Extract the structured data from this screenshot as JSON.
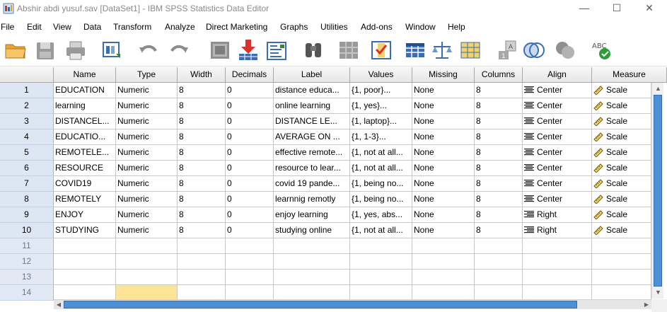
{
  "window": {
    "title": "Abshir abdi yusuf.sav [DataSet1] - IBM SPSS Statistics Data Editor",
    "minimize": "—",
    "maximize": "☐",
    "close": "✕"
  },
  "menu": [
    "File",
    "Edit",
    "View",
    "Data",
    "Transform",
    "Analyze",
    "Direct Marketing",
    "Graphs",
    "Utilities",
    "Add-ons",
    "Window",
    "Help"
  ],
  "toolbar": {
    "icons": [
      "open-folder-icon",
      "save-icon",
      "print-icon",
      "recall-dialog-icon",
      "undo-icon",
      "redo-icon",
      "goto-case-icon",
      "goto-variable-icon",
      "variables-icon",
      "find-icon",
      "insert-cases-icon",
      "insert-variable-icon",
      "split-file-icon",
      "weight-cases-icon",
      "select-cases-icon",
      "value-labels-icon",
      "use-sets-icon",
      "show-all-variables-icon",
      "spell-check-icon"
    ],
    "spell_label": "ABC"
  },
  "grid": {
    "columns": [
      "Name",
      "Type",
      "Width",
      "Decimals",
      "Label",
      "Values",
      "Missing",
      "Columns",
      "Align",
      "Measure"
    ],
    "rows": [
      {
        "num": "1",
        "name": "EDUCATION",
        "type": "Numeric",
        "width": "8",
        "decimals": "0",
        "label": "distance educa...",
        "values": "{1, poor}...",
        "missing": "None",
        "columns": "8",
        "align": "Center",
        "measure": "Scale"
      },
      {
        "num": "2",
        "name": "learning",
        "type": "Numeric",
        "width": "8",
        "decimals": "0",
        "label": "online learning",
        "values": "{1, yes}...",
        "missing": "None",
        "columns": "8",
        "align": "Center",
        "measure": "Scale"
      },
      {
        "num": "3",
        "name": "DISTANCEL...",
        "type": "Numeric",
        "width": "8",
        "decimals": "0",
        "label": "DISTANCE LE...",
        "values": "{1, laptop}...",
        "missing": "None",
        "columns": "8",
        "align": "Center",
        "measure": "Scale"
      },
      {
        "num": "4",
        "name": "EDUCATIO...",
        "type": "Numeric",
        "width": "8",
        "decimals": "0",
        "label": "AVERAGE ON ...",
        "values": "{1, 1-3}...",
        "missing": "None",
        "columns": "8",
        "align": "Center",
        "measure": "Scale"
      },
      {
        "num": "5",
        "name": "REMOTELE...",
        "type": "Numeric",
        "width": "8",
        "decimals": "0",
        "label": "effective remote...",
        "values": "{1, not at all...",
        "missing": "None",
        "columns": "8",
        "align": "Center",
        "measure": "Scale"
      },
      {
        "num": "6",
        "name": "RESOURCE",
        "type": "Numeric",
        "width": "8",
        "decimals": "0",
        "label": "resource to lear...",
        "values": "{1, not at all...",
        "missing": "None",
        "columns": "8",
        "align": "Center",
        "measure": "Scale"
      },
      {
        "num": "7",
        "name": "COVID19",
        "type": "Numeric",
        "width": "8",
        "decimals": "0",
        "label": "covid 19 pande...",
        "values": "{1, being no...",
        "missing": "None",
        "columns": "8",
        "align": "Center",
        "measure": "Scale"
      },
      {
        "num": "8",
        "name": "REMOTELY",
        "type": "Numeric",
        "width": "8",
        "decimals": "0",
        "label": "learnnig remotly",
        "values": "{1, being no...",
        "missing": "None",
        "columns": "8",
        "align": "Center",
        "measure": "Scale"
      },
      {
        "num": "9",
        "name": "ENJOY",
        "type": "Numeric",
        "width": "8",
        "decimals": "0",
        "label": "enjoy learning",
        "values": "{1, yes, abs...",
        "missing": "None",
        "columns": "8",
        "align": "Right",
        "measure": "Scale"
      },
      {
        "num": "10",
        "name": "STUDYING",
        "type": "Numeric",
        "width": "8",
        "decimals": "0",
        "label": "studying online",
        "values": "{1, not at all...",
        "missing": "None",
        "columns": "8",
        "align": "Right",
        "measure": "Scale"
      }
    ],
    "empty_rows": [
      "11",
      "12",
      "13",
      "14"
    ]
  },
  "colors": {
    "selected_cell": "#fde597",
    "row_header": "#dde6f3",
    "scroll_thumb": "#4f8fd6"
  }
}
